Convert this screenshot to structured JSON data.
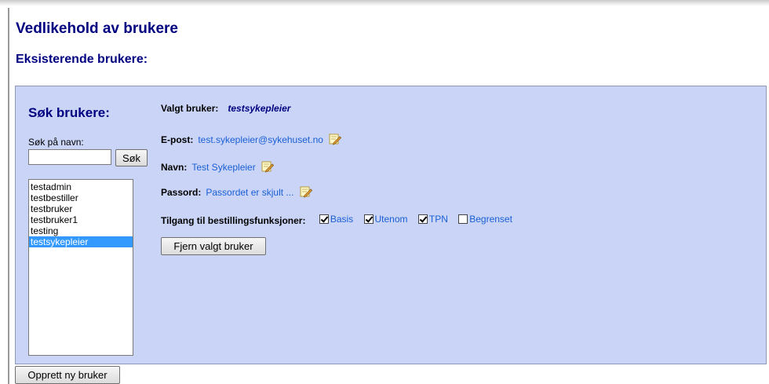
{
  "page": {
    "title": "Vedlikehold av brukere",
    "section_title": "Eksisterende brukere:"
  },
  "search": {
    "title": "Søk brukere:",
    "label": "Søk på navn:",
    "input_value": "",
    "button_label": "Søk"
  },
  "users": {
    "items": [
      "testadmin",
      "testbestiller",
      "testbruker",
      "testbruker1",
      "testing",
      "testsykepleier"
    ],
    "selected": "testsykepleier"
  },
  "details": {
    "selected_label": "Valgt bruker:",
    "selected_value": "testsykepleier",
    "email_label": "E-post:",
    "email_value": "test.sykepleier@sykehuset.no",
    "name_label": "Navn:",
    "name_value": "Test Sykepleier",
    "password_label": "Passord:",
    "password_value": "Passordet er skjult ...",
    "access_label": "Tilgang til bestillingsfunksjoner:",
    "access": [
      {
        "label": "Basis",
        "checked": true
      },
      {
        "label": "Utenom",
        "checked": true
      },
      {
        "label": "TPN",
        "checked": true
      },
      {
        "label": "Begrenset",
        "checked": false
      }
    ],
    "edit_icon": "edit-note-icon"
  },
  "buttons": {
    "remove": "Fjern valgt bruker",
    "create": "Opprett ny bruker"
  },
  "colors": {
    "heading": "#000080",
    "panel_bg": "#c9d4f6",
    "link": "#1a5fd6",
    "selection": "#3399ff"
  }
}
